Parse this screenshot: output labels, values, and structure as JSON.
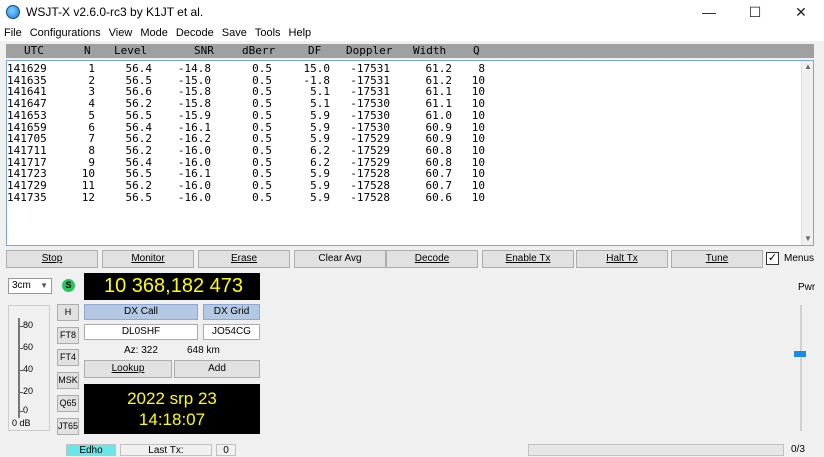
{
  "window": {
    "title": "WSJT-X   v2.6.0-rc3   by K1JT et al.",
    "minimize": "—",
    "maximize": "☐",
    "close": "✕"
  },
  "menu": [
    "File",
    "Configurations",
    "View",
    "Mode",
    "Decode",
    "Save",
    "Tools",
    "Help"
  ],
  "table": {
    "headers": [
      "UTC",
      "N",
      "Level",
      "SNR",
      "dBerr",
      "DF",
      "Doppler",
      "Width",
      "Q"
    ],
    "rows": [
      [
        "141629",
        "1",
        "56.4",
        "-14.8",
        "0.5",
        "15.0",
        "-17531",
        "61.2",
        "8"
      ],
      [
        "141635",
        "2",
        "56.5",
        "-15.0",
        "0.5",
        "-1.8",
        "-17531",
        "61.2",
        "10"
      ],
      [
        "141641",
        "3",
        "56.6",
        "-15.8",
        "0.5",
        "5.1",
        "-17531",
        "61.1",
        "10"
      ],
      [
        "141647",
        "4",
        "56.2",
        "-15.8",
        "0.5",
        "5.1",
        "-17530",
        "61.1",
        "10"
      ],
      [
        "141653",
        "5",
        "56.5",
        "-15.9",
        "0.5",
        "5.9",
        "-17530",
        "61.0",
        "10"
      ],
      [
        "141659",
        "6",
        "56.4",
        "-16.1",
        "0.5",
        "5.9",
        "-17530",
        "60.9",
        "10"
      ],
      [
        "141705",
        "7",
        "56.2",
        "-16.2",
        "0.5",
        "5.9",
        "-17529",
        "60.9",
        "10"
      ],
      [
        "141711",
        "8",
        "56.2",
        "-16.0",
        "0.5",
        "6.2",
        "-17529",
        "60.8",
        "10"
      ],
      [
        "141717",
        "9",
        "56.4",
        "-16.0",
        "0.5",
        "6.2",
        "-17529",
        "60.8",
        "10"
      ],
      [
        "141723",
        "10",
        "56.5",
        "-16.1",
        "0.5",
        "5.9",
        "-17528",
        "60.7",
        "10"
      ],
      [
        "141729",
        "11",
        "56.2",
        "-16.0",
        "0.5",
        "5.9",
        "-17528",
        "60.7",
        "10"
      ],
      [
        "141735",
        "12",
        "56.5",
        "-16.0",
        "0.5",
        "5.9",
        "-17528",
        "60.6",
        "10"
      ]
    ]
  },
  "buttons": {
    "stop": "Stop",
    "monitor": "Monitor",
    "erase": "Erase",
    "clear_avg": "Clear Avg",
    "decode": "Decode",
    "enable_tx": "Enable Tx",
    "halt_tx": "Halt Tx",
    "tune": "Tune",
    "menus": "Menus",
    "menus_checked": "✓"
  },
  "band": "3cm",
  "s_indicator": "S",
  "frequency": "10 368,182 473",
  "pwr_label": "Pwr",
  "modes": [
    "H",
    "FT8",
    "FT4",
    "MSK",
    "Q65",
    "JT65"
  ],
  "meter": {
    "ticks": [
      "80",
      "60",
      "40",
      "20",
      "0"
    ],
    "unit": "0 dB"
  },
  "dx": {
    "call_label": "DX Call",
    "grid_label": "DX Grid",
    "call": "DL0SHF",
    "grid": "JO54CG",
    "az": "Az: 322",
    "distance": "648 km",
    "lookup": "Lookup",
    "add": "Add"
  },
  "clock": {
    "date": "2022 srp 23",
    "time": "14:18:07"
  },
  "status": {
    "mode_label": "Edho",
    "last_tx_label": "Last Tx:",
    "last_tx_value": "0",
    "counter": "0/3"
  },
  "colors": {
    "display_bg": "#000000",
    "display_fg": "#ffff00",
    "dx_header": "#b4c8e4",
    "status_mode": "#6ae6e6",
    "slider": "#1e88e5"
  }
}
